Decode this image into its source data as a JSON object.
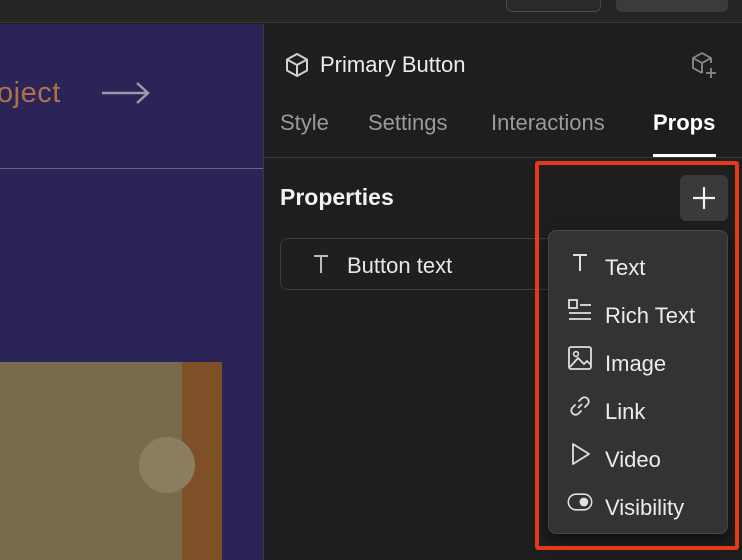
{
  "canvas": {
    "link_text": "oject"
  },
  "panel": {
    "component_title": "Primary Button",
    "tabs": [
      {
        "label": "Style"
      },
      {
        "label": "Settings"
      },
      {
        "label": "Interactions"
      },
      {
        "label": "Props"
      }
    ],
    "active_tab": "Props",
    "section_title": "Properties",
    "properties": [
      {
        "icon": "text-type-icon",
        "label": "Button text"
      }
    ]
  },
  "add_menu": {
    "items": [
      {
        "icon": "text-type-icon",
        "label": "Text"
      },
      {
        "icon": "rich-text-icon",
        "label": "Rich Text"
      },
      {
        "icon": "image-icon",
        "label": "Image"
      },
      {
        "icon": "link-icon",
        "label": "Link"
      },
      {
        "icon": "video-play-icon",
        "label": "Video"
      },
      {
        "icon": "visibility-toggle-icon",
        "label": "Visibility"
      }
    ]
  },
  "colors": {
    "canvas_background": "#2a2556",
    "panel_background": "#1e1e1e",
    "highlight_border": "#e23a1b",
    "link_text": "#b0704a"
  }
}
